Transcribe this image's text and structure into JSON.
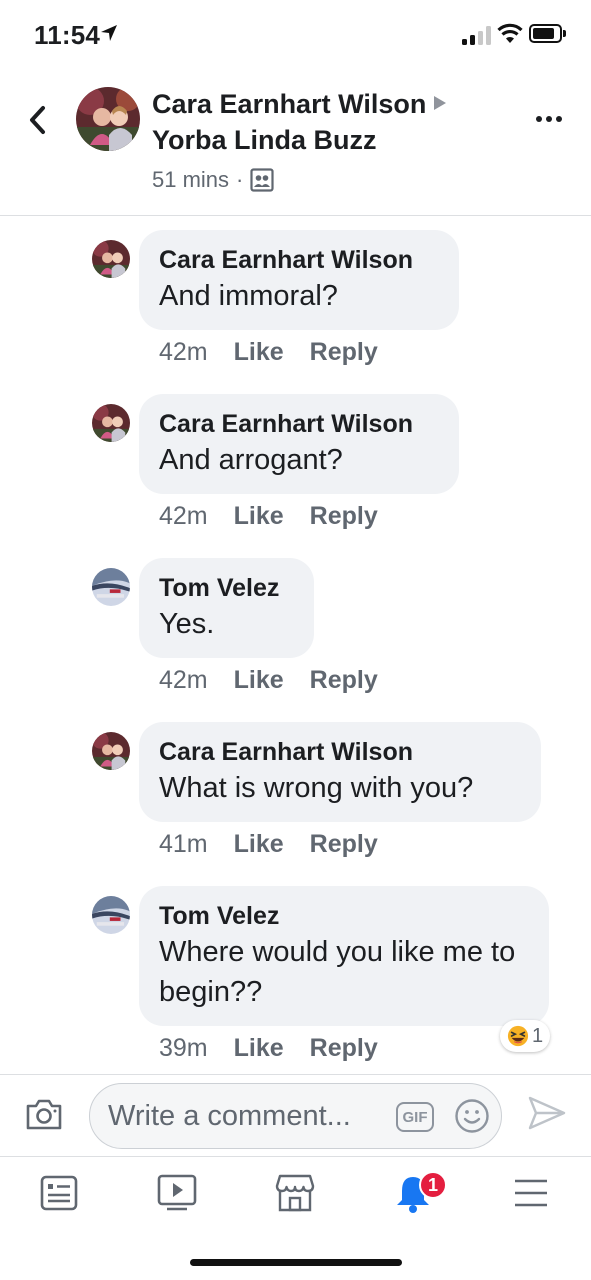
{
  "status_bar": {
    "time": "11:54"
  },
  "header": {
    "author": "Cara Earnhart Wilson",
    "group": "Yorba Linda Buzz",
    "time": "51 mins",
    "separator": "·"
  },
  "comments": [
    {
      "author": "Cara Earnhart Wilson",
      "text": "And immoral?",
      "time": "42m",
      "like": "Like",
      "reply": "Reply",
      "avatar": "cara"
    },
    {
      "author": "Cara Earnhart Wilson",
      "text": "And arrogant?",
      "time": "42m",
      "like": "Like",
      "reply": "Reply",
      "avatar": "cara"
    },
    {
      "author": "Tom Velez",
      "text": "Yes.",
      "time": "42m",
      "like": "Like",
      "reply": "Reply",
      "avatar": "tom"
    },
    {
      "author": "Cara Earnhart Wilson",
      "text": "What is wrong with you?",
      "time": "41m",
      "like": "Like",
      "reply": "Reply",
      "avatar": "cara"
    },
    {
      "author": "Tom Velez",
      "text": "Where would you like me to begin??",
      "time": "39m",
      "like": "Like",
      "reply": "Reply",
      "avatar": "tom",
      "reaction_count": "1"
    }
  ],
  "composer": {
    "placeholder": "Write a comment...",
    "gif": "GIF"
  },
  "tabs": [
    {
      "name": "news-feed",
      "icon": "feed-icon"
    },
    {
      "name": "watch",
      "icon": "play-icon"
    },
    {
      "name": "marketplace",
      "icon": "shop-icon"
    },
    {
      "name": "notifications",
      "icon": "bell-icon",
      "badge": "1"
    },
    {
      "name": "menu",
      "icon": "menu-icon"
    }
  ],
  "colors": {
    "accent": "#1877f2",
    "bubble": "#f0f2f5",
    "muted": "#606770",
    "badge": "#e41e3f"
  }
}
